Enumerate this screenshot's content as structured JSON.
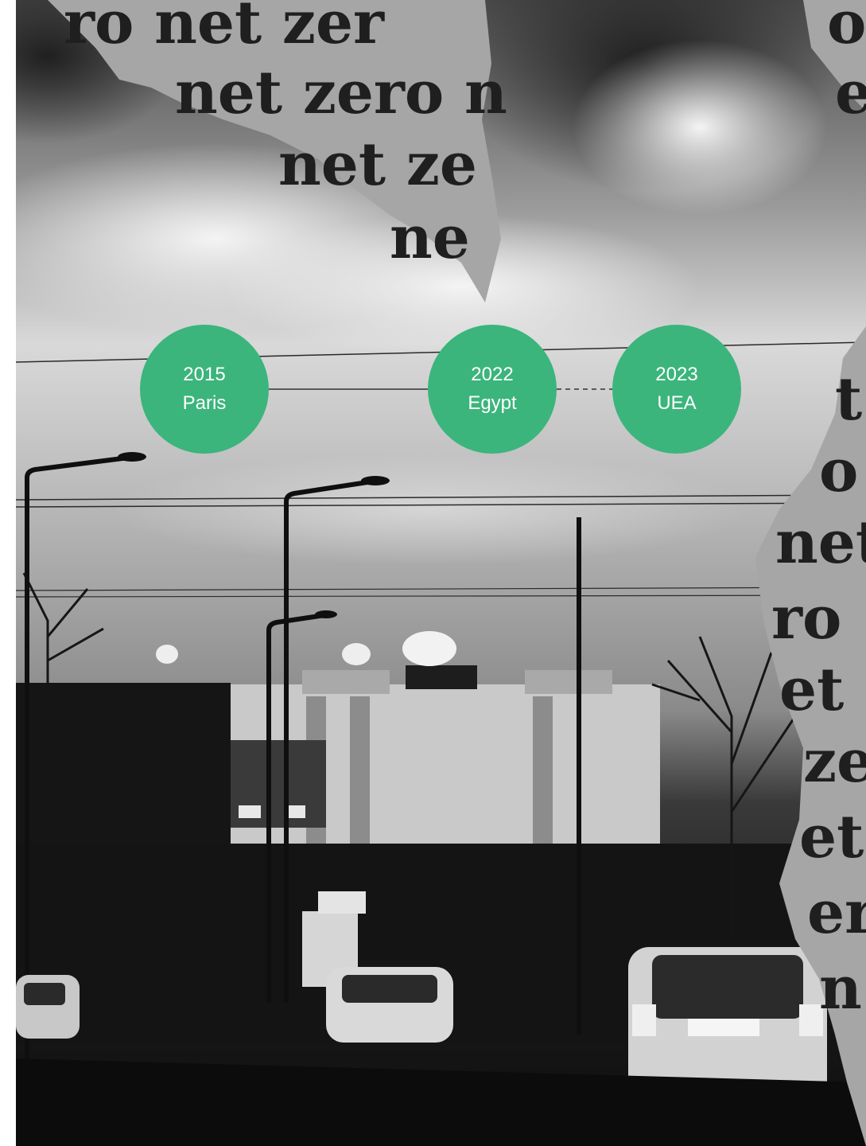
{
  "background_text": {
    "left_fragments": [
      "ro net zer",
      "net zero n",
      "net ze",
      "ne"
    ],
    "right_fragments": [
      "o",
      "e",
      "t",
      "o",
      "net",
      "ro",
      "et",
      "zer",
      "et",
      "er",
      "n"
    ]
  },
  "timeline": {
    "accent_color": "#3bb57c",
    "milestones": [
      {
        "year": "2015",
        "place": "Paris"
      },
      {
        "year": "2022",
        "place": "Egypt"
      },
      {
        "year": "2023",
        "place": "UEA"
      }
    ]
  }
}
